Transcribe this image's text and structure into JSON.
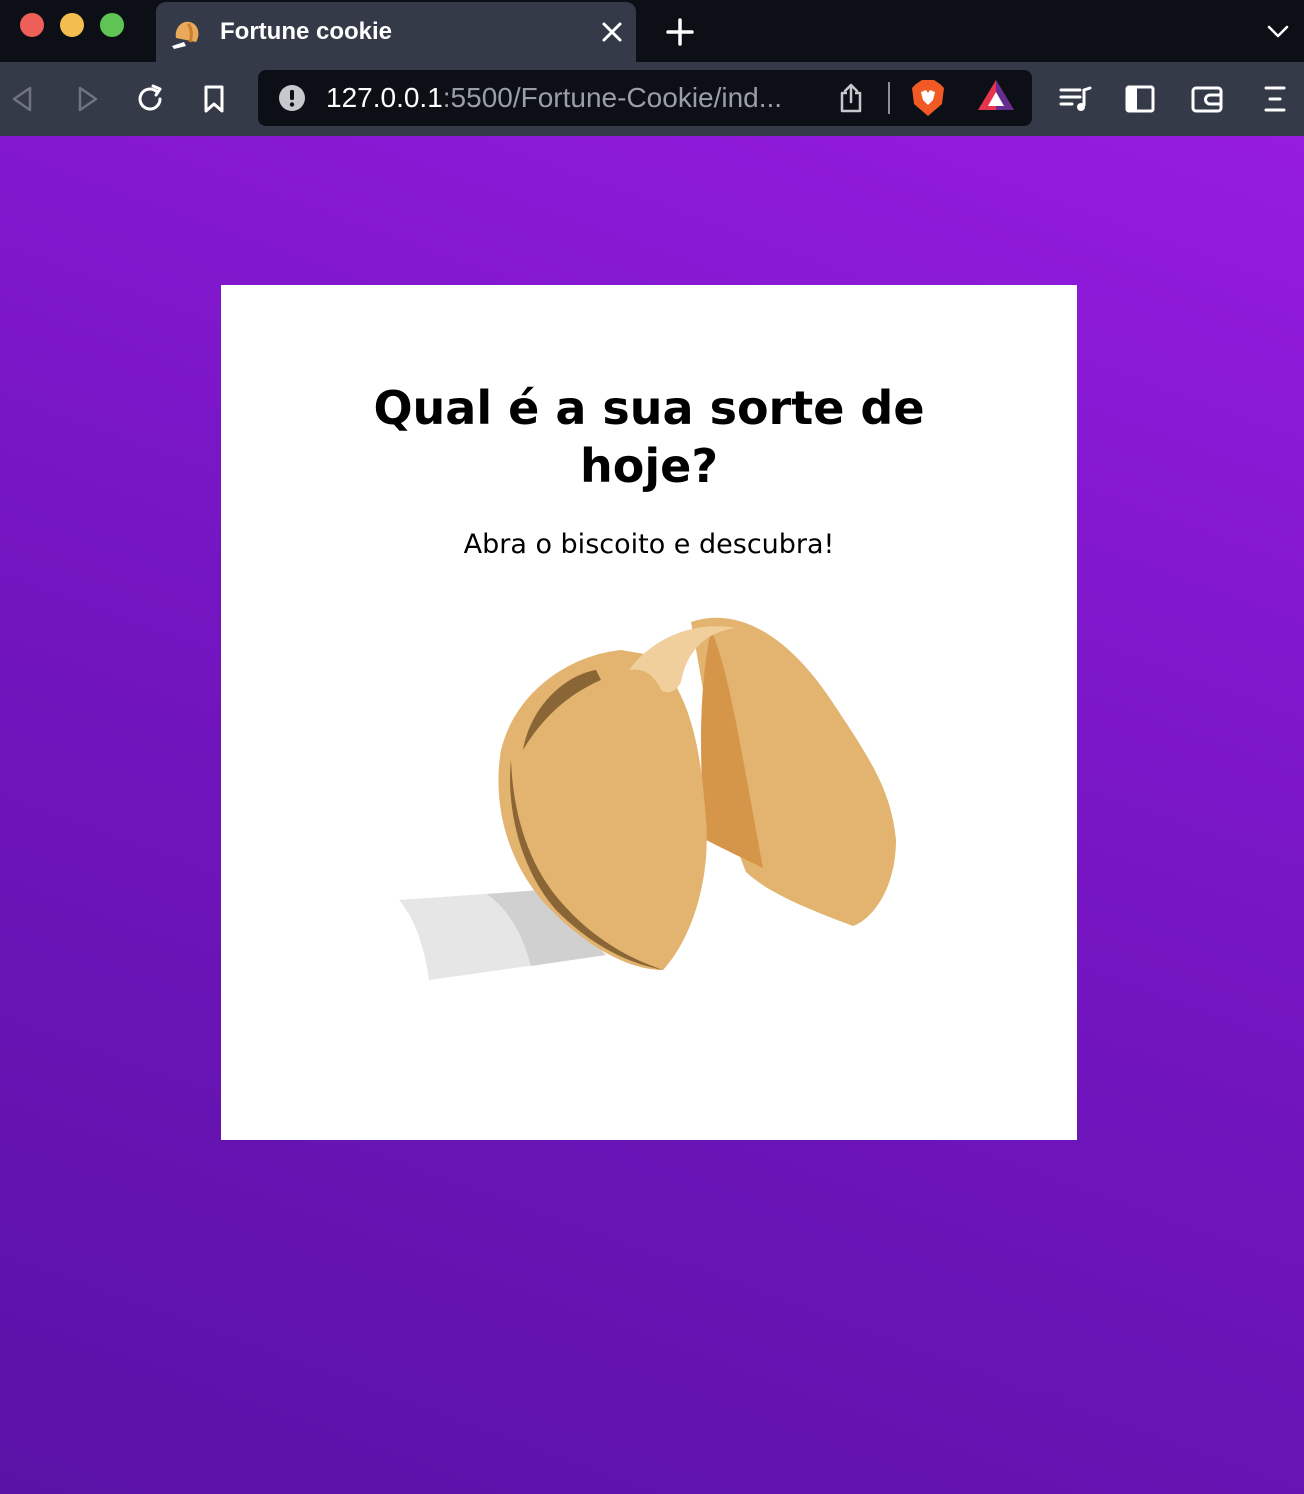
{
  "browser": {
    "tab": {
      "title": "Fortune cookie",
      "favicon": "fortune-cookie-icon"
    },
    "address_bar": {
      "host": "127.0.0.1",
      "path": ":5500/Fortune-Cookie/ind...",
      "security_icon": "info-icon"
    },
    "colors": {
      "titlebar": "#0d0f17",
      "toolbar": "#353a48",
      "traffic_red": "#ee5f57",
      "traffic_yellow": "#f4bd4f",
      "traffic_green": "#5fc454"
    }
  },
  "page": {
    "title": "Qual é a sua sorte de hoje?",
    "subtitle": "Abra o biscoito e descubra!",
    "image": "fortune-cookie-illustration",
    "colors": {
      "background_top": "#961ce0",
      "background_bottom": "#5a12a6",
      "card": "#ffffff",
      "cookie": "#e2b46f",
      "cookie_shadow": "#d6964a",
      "paper": "#e6e6e6"
    }
  }
}
